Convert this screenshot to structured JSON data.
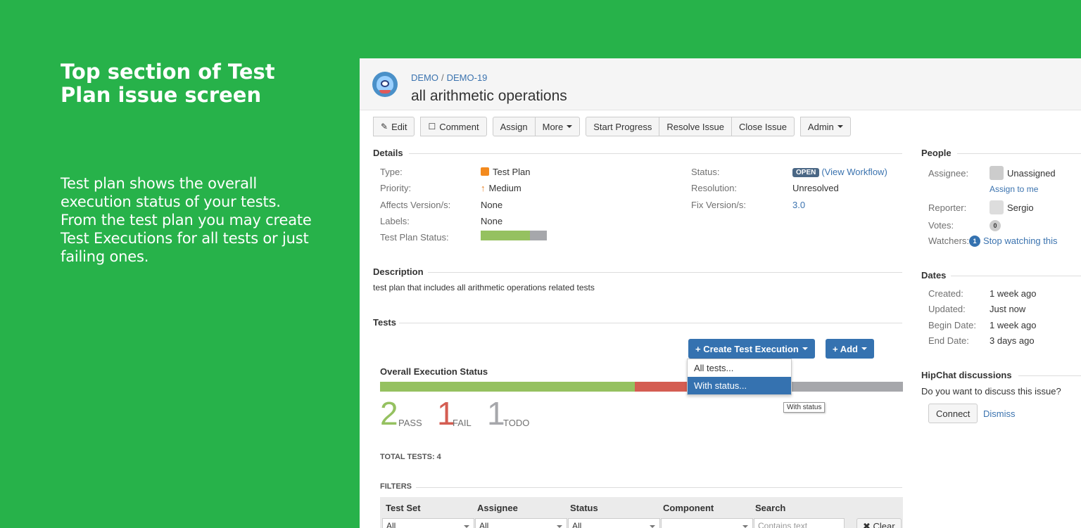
{
  "slide": {
    "title": "Top section of Test Plan issue screen",
    "description": "Test plan shows the overall execution status of your tests. From the test plan you may create Test Executions for all tests or just failing ones."
  },
  "header": {
    "breadcrumb_project": "DEMO",
    "breadcrumb_separator": "/",
    "breadcrumb_issue": "DEMO-19",
    "title": "all arithmetic operations"
  },
  "toolbar": {
    "edit": "Edit",
    "comment": "Comment",
    "assign": "Assign",
    "more": "More",
    "start_progress": "Start Progress",
    "resolve_issue": "Resolve Issue",
    "close_issue": "Close Issue",
    "admin": "Admin"
  },
  "details": {
    "heading": "Details",
    "type_label": "Type:",
    "type_value": "Test Plan",
    "priority_label": "Priority:",
    "priority_value": "Medium",
    "affects_label": "Affects Version/s:",
    "affects_value": "None",
    "labels_label": "Labels:",
    "labels_value": "None",
    "tp_status_label": "Test Plan Status:",
    "test_plan_status": {
      "pass_fraction": 0.75,
      "todo_fraction": 0.25
    },
    "status_label": "Status:",
    "status_value": "OPEN",
    "view_workflow": "(View Workflow)",
    "resolution_label": "Resolution:",
    "resolution_value": "Unresolved",
    "fix_label": "Fix Version/s:",
    "fix_value": "3.0"
  },
  "description": {
    "heading": "Description",
    "text": "test plan that includes all arithmetic operations related tests"
  },
  "tests": {
    "heading": "Tests",
    "create_exec_button": "+ Create Test Execution",
    "add_button": "+ Add",
    "dropdown_items": [
      "All tests...",
      "With status..."
    ],
    "tooltip": "With status",
    "overall_heading": "Overall Execution Status",
    "pass_count": "2",
    "pass_label": "PASS",
    "fail_count": "1",
    "fail_label": "FAIL",
    "todo_count": "1",
    "todo_label": "TODO",
    "total_label": "TOTAL TESTS: 4",
    "filters_heading": "FILTERS",
    "bar": {
      "pass": 2,
      "fail": 1,
      "todo": 1
    }
  },
  "filters": {
    "columns": [
      "Test Set",
      "Assignee",
      "Status",
      "Component",
      "Search"
    ],
    "selects": [
      "All",
      "All",
      "All",
      ""
    ],
    "search_placeholder": "Contains text",
    "clear": "Clear"
  },
  "people": {
    "heading": "People",
    "assignee_label": "Assignee:",
    "assignee_value": "Unassigned",
    "assign_to_me": "Assign to me",
    "reporter_label": "Reporter:",
    "reporter_value": "Sergio",
    "votes_label": "Votes:",
    "votes_count": "0",
    "watchers_label": "Watchers:",
    "watchers_count": "1",
    "stop_watching": "Stop watching this"
  },
  "dates": {
    "heading": "Dates",
    "created_label": "Created:",
    "created_value": "1 week ago",
    "updated_label": "Updated:",
    "updated_value": "Just now",
    "begin_label": "Begin Date:",
    "begin_value": "1 week ago",
    "end_label": "End Date:",
    "end_value": "3 days ago"
  },
  "hipchat": {
    "heading": "HipChat discussions",
    "text": "Do you want to discuss this issue?",
    "connect": "Connect",
    "dismiss": "Dismiss"
  },
  "colors": {
    "background": "#27b24a",
    "pass": "#95c160",
    "fail": "#d45d52",
    "todo": "#a6a7ab",
    "primary": "#3572b0",
    "link": "#3b73af"
  }
}
